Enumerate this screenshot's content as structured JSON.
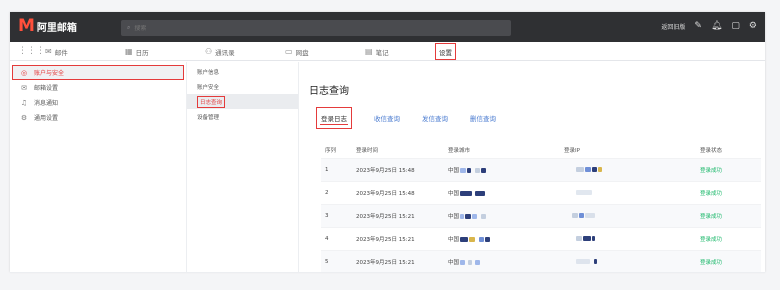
{
  "header": {
    "logo_mark": "M",
    "logo_text": "阿里邮箱",
    "search_icon": "magnifier-icon",
    "search_placeholder": "搜索",
    "old_version_link": "返回旧版"
  },
  "nav": {
    "grid_icon": "⋮⋮⋮",
    "tabs": [
      {
        "label": "邮件",
        "icon": "✉"
      },
      {
        "label": "日历",
        "icon": "▦"
      },
      {
        "label": "通讯录",
        "icon": "⚇"
      },
      {
        "label": "网盘",
        "icon": "▭"
      },
      {
        "label": "笔记",
        "icon": "▤"
      },
      {
        "label": "设置",
        "icon": ""
      }
    ]
  },
  "sidebar": {
    "items": [
      {
        "label": "账户与安全",
        "icon": "◎"
      },
      {
        "label": "邮箱设置",
        "icon": "✉"
      },
      {
        "label": "消息通知",
        "icon": "♫"
      },
      {
        "label": "通用设置",
        "icon": "⚙"
      }
    ]
  },
  "subnav": {
    "items": [
      "账户信息",
      "账户安全",
      "日志查询",
      "设备管理"
    ]
  },
  "main": {
    "title": "日志查询",
    "tabs": [
      "登录日志",
      "收信查询",
      "发信查询",
      "删信查询"
    ]
  },
  "table": {
    "headers": [
      "序列",
      "登录时间",
      "登录城市",
      "登录IP",
      "登录状态"
    ],
    "rows": [
      {
        "idx": "1",
        "time": "2023年9月25日 15:48",
        "city": "中国",
        "status": "登录成功"
      },
      {
        "idx": "2",
        "time": "2023年9月25日 15:48",
        "city": "中国",
        "status": "登录成功"
      },
      {
        "idx": "3",
        "time": "2023年9月25日 15:21",
        "city": "中国",
        "status": "登录成功"
      },
      {
        "idx": "4",
        "time": "2023年9月25日 15:21",
        "city": "中国",
        "status": "登录成功"
      },
      {
        "idx": "5",
        "time": "2023年9月25日 15:21",
        "city": "中国",
        "status": "登录成功"
      }
    ]
  },
  "colors": {
    "accent_red": "#e43b3b",
    "success_green": "#1bb86a",
    "link_blue": "#4a7bd0",
    "topbar_dark": "#2f3033"
  }
}
